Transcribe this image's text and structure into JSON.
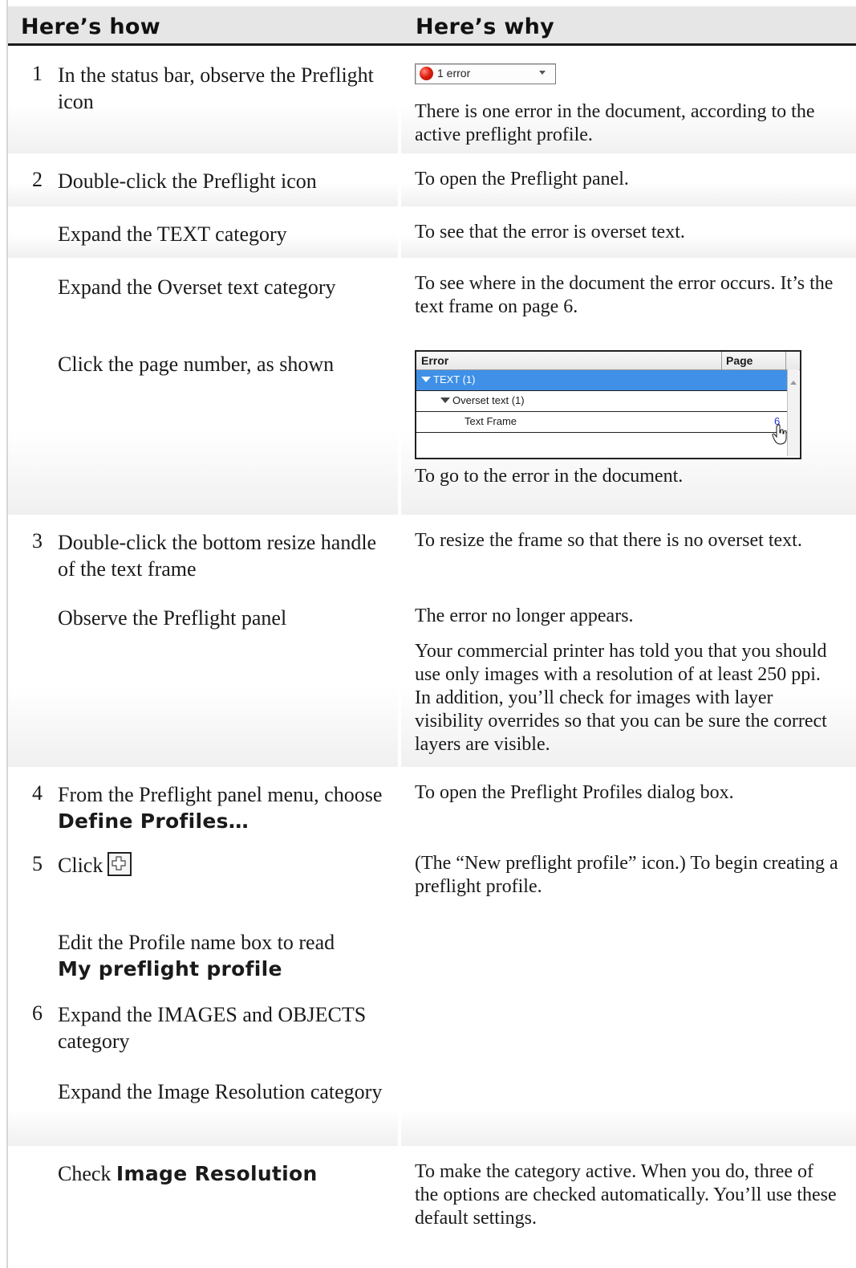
{
  "header": {
    "how": "Here’s how",
    "why": "Here’s why"
  },
  "status_widget": {
    "text": "1 error",
    "status_color": "#e02010"
  },
  "panel": {
    "col_error": "Error",
    "col_page": "Page",
    "rows": [
      {
        "label": "TEXT (1)",
        "selected": true
      },
      {
        "label": "Overset text (1)"
      },
      {
        "label": "Text Frame",
        "page": "6"
      }
    ],
    "selection_color": "#3f90e6"
  },
  "steps": {
    "s1": {
      "num": "1",
      "text": "In the status bar, observe the Preflight icon",
      "why": "There is one error in the document, according to the active preflight profile."
    },
    "s2": {
      "num": "2",
      "text": "Double-click the Preflight icon",
      "why": "To open the Preflight panel."
    },
    "s2b": {
      "text": "Expand the TEXT category",
      "why": "To see that the error is overset text."
    },
    "s2c": {
      "text": "Expand the Overset text category",
      "why": "To see where in the document the error occurs. It’s the text frame on page 6."
    },
    "s2d": {
      "text": "Click the page number, as shown",
      "why": "To go to the error in the document."
    },
    "s3": {
      "num": "3",
      "text": "Double-click the bottom resize handle of the text frame",
      "why": "To resize the frame so that there is no overset text."
    },
    "s3b": {
      "text": "Observe the Preflight panel",
      "why": "The error no longer appears.",
      "why2": "Your commercial printer has told you that you should use only images with a resolution of at least 250 ppi. In addition, you’ll check for images with layer visibility overrides so that you can be sure the correct layers are visible."
    },
    "s4": {
      "num": "4",
      "text": "From the Preflight panel menu, choose",
      "bold": "Define Profiles…",
      "why": "To open the Preflight Profiles dialog box."
    },
    "s5": {
      "num": "5",
      "text": "Click",
      "icon": "new-preflight-profile-icon",
      "why": "(The “New preflight profile” icon.) To begin creating a preflight profile."
    },
    "s5b": {
      "text": "Edit the Profile name box to read",
      "bold": "My preflight profile"
    },
    "s6": {
      "num": "6",
      "text": "Expand the IMAGES and OBJECTS category"
    },
    "s6b": {
      "text": "Expand the Image Resolution category"
    },
    "s6c": {
      "text": "Check",
      "bold": "Image Resolution",
      "why": "To make the category active. When you do, three of the options are checked automatically. You’ll use these default settings."
    }
  }
}
